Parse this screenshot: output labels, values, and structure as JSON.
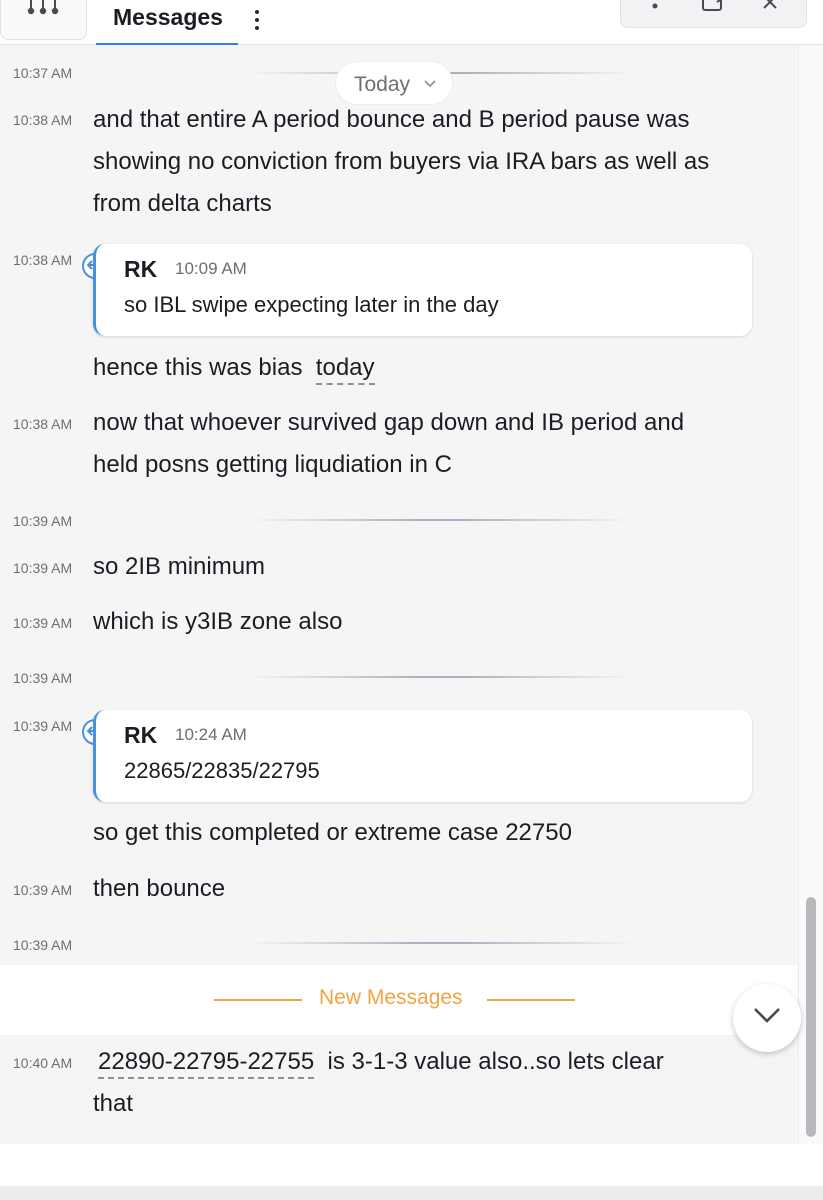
{
  "header": {
    "tab_label": "Messages",
    "apps_icon": "apps-dots-icon",
    "more_icon": "kebab-menu-icon",
    "window_icons": [
      "more-icon",
      "popout-icon",
      "close-icon"
    ]
  },
  "date_pill": {
    "label": "Today",
    "icon": "chevron-down-icon"
  },
  "messages": [
    {
      "time": "10:37 AM",
      "text": ""
    },
    {
      "time": "10:38 AM",
      "lines": [
        "and that entire A period bounce and B period pause was",
        "showing no conviction from buyers via IRA bars as well as",
        "from delta charts"
      ]
    },
    {
      "time": "10:38 AM",
      "quote": {
        "author": "RK",
        "time": "10:09 AM",
        "text": "so IBL swipe expecting later in the day"
      },
      "text_before": "hence this was bias",
      "text_link": "today"
    },
    {
      "time": "10:38 AM",
      "lines": [
        "now that whoever survived gap down and IB period and",
        "held posns getting liqudiation in C"
      ]
    },
    {
      "time": "10:39 AM",
      "text": ""
    },
    {
      "time": "10:39 AM",
      "text": "so 2IB minimum"
    },
    {
      "time": "10:39 AM",
      "text": "which is y3IB zone also"
    },
    {
      "time": "10:39 AM",
      "text": ""
    },
    {
      "time": "10:39 AM",
      "quote": {
        "author": "RK",
        "time": "10:24 AM",
        "text": "22865/22835/22795"
      },
      "text": "so get this completed or extreme case 22750"
    },
    {
      "time": "10:39 AM",
      "text": "then bounce"
    },
    {
      "time": "10:39 AM",
      "text": ""
    }
  ],
  "new_messages_label": "New Messages",
  "last_message": {
    "time": "10:40 AM",
    "link": "22890-22795-22755",
    "rest_line1": "is  3-1-3 value also..so lets clear",
    "line2": "that"
  },
  "colors": {
    "accent_blue": "#2f80ed",
    "new_messages_orange": "#f0a442",
    "chat_bg": "#f5f5f6",
    "quote_border": "#4a90e2"
  }
}
